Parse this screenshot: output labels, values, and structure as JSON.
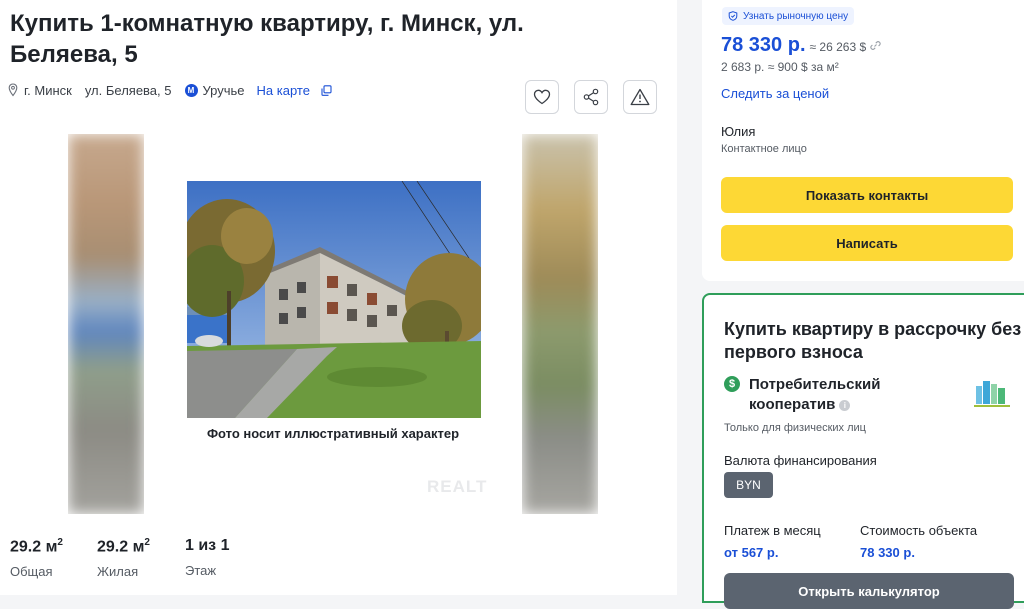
{
  "listing": {
    "title": "Купить 1-комнатную квартиру, г. Минск, ул. Беляева, 5",
    "address": {
      "city": "г. Минск",
      "street": "ул. Беляева, 5",
      "metro_letter": "М",
      "metro": "Уручье",
      "map_link": "На карте",
      "pin_icon": "location-pin-icon",
      "copy_icon": "copy-icon"
    },
    "actions": [
      "heart-icon",
      "share-icon",
      "warning-icon"
    ],
    "photo_caption": "Фото носит иллюстративный характер",
    "watermark": "REALT",
    "stats": [
      {
        "value": "29.2 м",
        "sup": "2",
        "label": "Общая"
      },
      {
        "value": "29.2 м",
        "sup": "2",
        "label": "Жилая"
      },
      {
        "value": "1 из 1",
        "sup": "",
        "label": "Этаж"
      }
    ]
  },
  "price_card": {
    "badge": "Узнать рыночную цену",
    "price": "78 330 р.",
    "price_usd": "≈ 26 263 $",
    "per_meter": "2 683 р. ≈ 900 $ за м²",
    "follow": "Следить за ценой",
    "contact_name": "Юлия",
    "contact_role": "Контактное лицо",
    "show_contacts": "Показать контакты",
    "write": "Написать"
  },
  "installment_card": {
    "title": "Купить квартиру в рассрочку без первого взноса",
    "coop_icon": "$",
    "coop_name": "Потребительский кооператив",
    "info_icon": "i",
    "only_individuals": "Только для физических лиц",
    "currency_label": "Валюта финансирования",
    "currency": "BYN",
    "monthly_label": "Платеж в месяц",
    "monthly_value": "от 567 р.",
    "cost_label": "Стоимость объекта",
    "cost_value": "78 330 р.",
    "calculator": "Открыть калькулятор"
  },
  "colors": {
    "accent_blue": "#1a4fd6",
    "button_yellow": "#fdd835",
    "green_border": "#2f9e5a",
    "dark_button": "#5b6470"
  }
}
